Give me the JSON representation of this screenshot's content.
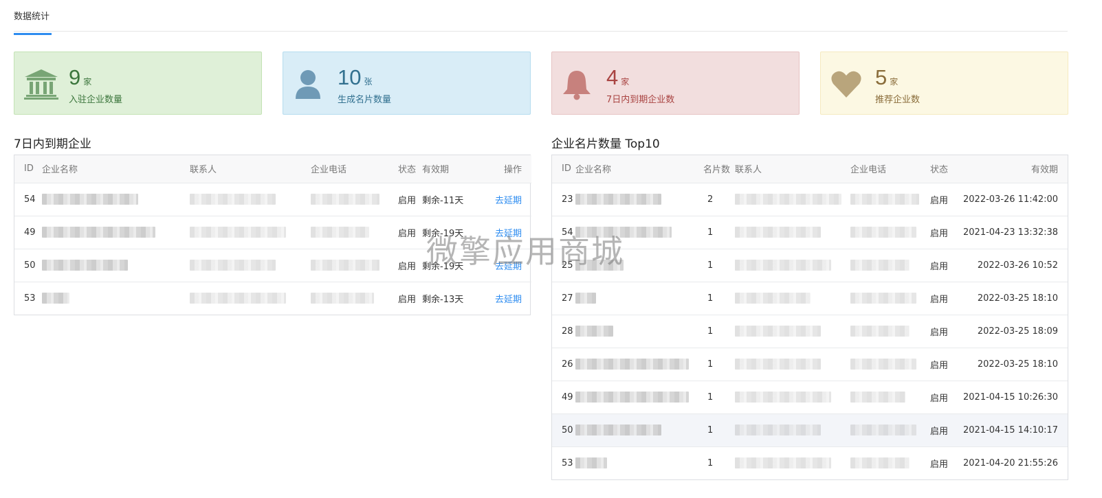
{
  "tabs": [
    {
      "label": "数据统计"
    }
  ],
  "cards": [
    {
      "value": "9",
      "unit": "家",
      "label": "入驻企业数量",
      "icon": "bank-icon"
    },
    {
      "value": "10",
      "unit": "张",
      "label": "生成名片数量",
      "icon": "user-icon"
    },
    {
      "value": "4",
      "unit": "家",
      "label": "7日内到期企业数",
      "icon": "bell-icon"
    },
    {
      "value": "5",
      "unit": "家",
      "label": "推荐企业数",
      "icon": "heart-icon"
    }
  ],
  "colors": {
    "green_bg": "#dff0d8",
    "green_border": "#c3e2b4",
    "green_text": "#3c763d",
    "green_icon": "#78a575",
    "blue_bg": "#d9edf7",
    "blue_border": "#b5dcef",
    "blue_text": "#31708f",
    "blue_icon": "#6f9ab6",
    "red_bg": "#f2dede",
    "red_border": "#e6c3c3",
    "red_text": "#a94442",
    "red_icon": "#c7817d",
    "yellow_bg": "#fcf8e3",
    "yellow_border": "#f5eac0",
    "yellow_text": "#8a6d3b",
    "yellow_icon": "#b9a57c",
    "link": "#2d8cf0"
  },
  "expiring": {
    "title": "7日内到期企业",
    "headers": [
      "ID",
      "企业名称",
      "联系人",
      "企业电话",
      "状态",
      "有效期",
      "操作"
    ],
    "rows": [
      {
        "id": "54",
        "status": "启用",
        "validity": "剩余-11天",
        "action": "去延期"
      },
      {
        "id": "49",
        "status": "启用",
        "validity": "剩余-19天",
        "action": "去延期"
      },
      {
        "id": "50",
        "status": "启用",
        "validity": "剩余-19天",
        "action": "去延期"
      },
      {
        "id": "53",
        "status": "启用",
        "validity": "剩余-13天",
        "action": "去延期"
      }
    ]
  },
  "top10": {
    "title": "企业名片数量 Top10",
    "headers": [
      "ID",
      "企业名称",
      "名片数",
      "联系人",
      "企业电话",
      "状态",
      "有效期"
    ],
    "rows": [
      {
        "id": "23",
        "cards": "2",
        "status": "启用",
        "validity": "2022-03-26 11:42:00"
      },
      {
        "id": "54",
        "cards": "1",
        "status": "启用",
        "validity": "2021-04-23 13:32:38"
      },
      {
        "id": "25",
        "cards": "1",
        "status": "启用",
        "validity": "2022-03-26 10:52"
      },
      {
        "id": "27",
        "cards": "1",
        "status": "启用",
        "validity": "2022-03-25 18:10"
      },
      {
        "id": "28",
        "cards": "1",
        "status": "启用",
        "validity": "2022-03-25 18:09"
      },
      {
        "id": "26",
        "cards": "1",
        "status": "启用",
        "validity": "2022-03-25 18:10"
      },
      {
        "id": "49",
        "cards": "1",
        "status": "启用",
        "validity": "2021-04-15 10:26:30"
      },
      {
        "id": "50",
        "cards": "1",
        "status": "启用",
        "validity": "2021-04-15 14:10:17"
      },
      {
        "id": "53",
        "cards": "1",
        "status": "启用",
        "validity": "2021-04-20 21:55:26"
      }
    ]
  },
  "watermark": "微擎应用商城"
}
